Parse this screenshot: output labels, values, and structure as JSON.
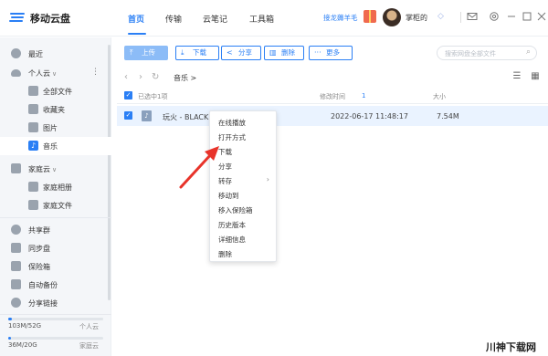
{
  "app": {
    "name": "移动云盘"
  },
  "nav": [
    {
      "label": "首页",
      "active": true
    },
    {
      "label": "传输",
      "active": false
    },
    {
      "label": "云笔记",
      "active": false
    },
    {
      "label": "工具箱",
      "active": false
    }
  ],
  "header": {
    "promo": "接龙薅羊毛",
    "username": "掌柜的",
    "icons": [
      "mail-icon",
      "settings-icon",
      "minimize-icon",
      "maximize-icon",
      "close-icon"
    ]
  },
  "sidebar": {
    "recent": "最近",
    "personal_cloud": "个人云",
    "personal_items": [
      "全部文件",
      "收藏夹",
      "图片",
      "音乐"
    ],
    "family_cloud": "家庭云",
    "family_items": [
      "家庭相册",
      "家庭文件"
    ],
    "others": [
      "共享群",
      "同步盘",
      "保险箱",
      "自动备份",
      "分享链接"
    ],
    "storage": [
      {
        "used": "103M/52G",
        "label": "个人云",
        "fraction": 0.02
      },
      {
        "used": "36M/20G",
        "label": "家庭云",
        "fraction": 0.02
      }
    ]
  },
  "toolbar": {
    "upload": "上传",
    "download": "下载",
    "share": "分享",
    "delete": "删除",
    "more": "更多",
    "search_placeholder": "搜索网盘全部文件"
  },
  "breadcrumb": {
    "current": "音乐 >"
  },
  "table": {
    "selected": "已选中1项",
    "modified_header": "修改时间",
    "sort_indicator": "1",
    "size_header": "大小",
    "rows": [
      {
        "name": "玩火 - BLACKP",
        "modified": "2022-06-17 11:48:17",
        "size": "7.54M"
      }
    ]
  },
  "context_menu": [
    "在线播放",
    "打开方式",
    "下载",
    "分享",
    "转存",
    "移动到",
    "移入保险箱",
    "历史版本",
    "详细信息",
    "删除"
  ],
  "watermark": "川神下载网",
  "colors": {
    "accent": "#2a7ff5",
    "arrow": "#e8332a"
  }
}
